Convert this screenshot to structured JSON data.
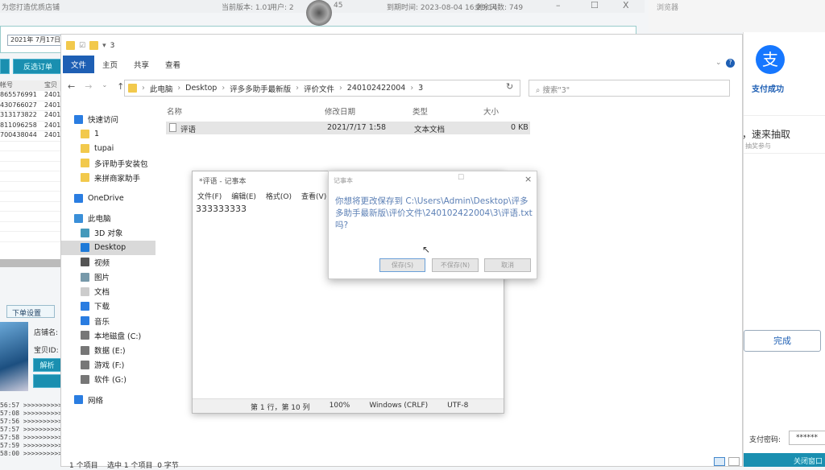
{
  "app": {
    "title": "为您打造优质店铺",
    "version": "当前版本: 1.01",
    "user": "用户: 2",
    "user_tail": "45",
    "expiry": "到期时间: 2023-08-04 16:29:14",
    "days_left": "剩余天数: 749",
    "date_from": "2021年 7月17日",
    "invert_button": "反选订单",
    "table": {
      "headers": [
        "帐号",
        "宝贝"
      ],
      "rows": [
        [
          "865576991",
          "2401"
        ],
        [
          "430766027",
          "2401"
        ],
        [
          "313173822",
          "2401"
        ],
        [
          "811096258",
          "2401"
        ],
        [
          "700438044",
          "2401"
        ]
      ]
    },
    "order_tab": "下单设置",
    "shop_label": "店铺名:",
    "item_label": "宝贝ID:",
    "parse_button": "解析",
    "logs": [
      "56:57 >>>>>>>>>>",
      "57:08 >>>>>>>>>>",
      "57:56 >>>>>>>>>>",
      "57:57 >>>>>>>>>>",
      "57:58 >>>>>>>>>>",
      "57:59 >>>>>>>>>>",
      "58:00 >>>>>>>>>>"
    ]
  },
  "browser": {
    "title": "浏览器",
    "pay_success": "支付成功",
    "promo": "，速来抽取",
    "promo_sub": "抽奖参与",
    "done": "完成",
    "password_label": "支付密码:",
    "password_value": "******",
    "close": "关闭窗口",
    "accent": "#1677ff"
  },
  "explorer": {
    "title": "3",
    "ribbon": [
      "文件",
      "主页",
      "共享",
      "查看"
    ],
    "path": [
      "此电脑",
      "Desktop",
      "评多多助手最新版",
      "评价文件",
      "240102422004",
      "3"
    ],
    "search_placeholder": "搜索\"3\"",
    "nav": [
      {
        "label": "快速访问",
        "icon": "star-icon",
        "top": true
      },
      {
        "label": "1",
        "icon": "folder-icon"
      },
      {
        "label": "tupai",
        "icon": "folder-icon"
      },
      {
        "label": "多评助手安装包",
        "icon": "folder-icon"
      },
      {
        "label": "来拼商家助手",
        "icon": "folder-icon"
      },
      {
        "label": "OneDrive",
        "icon": "cloud-icon",
        "top": true
      },
      {
        "label": "此电脑",
        "icon": "computer-icon",
        "top": true
      },
      {
        "label": "3D 对象",
        "icon": "cube-icon"
      },
      {
        "label": "Desktop",
        "icon": "desktop-icon",
        "selected": true
      },
      {
        "label": "视频",
        "icon": "video-icon"
      },
      {
        "label": "图片",
        "icon": "picture-icon"
      },
      {
        "label": "文档",
        "icon": "document-icon"
      },
      {
        "label": "下载",
        "icon": "download-icon"
      },
      {
        "label": "音乐",
        "icon": "music-icon"
      },
      {
        "label": "本地磁盘 (C:)",
        "icon": "drive-icon"
      },
      {
        "label": "数据 (E:)",
        "icon": "drive-icon"
      },
      {
        "label": "游戏 (F:)",
        "icon": "drive-icon"
      },
      {
        "label": "软件 (G:)",
        "icon": "drive-icon"
      },
      {
        "label": "网络",
        "icon": "network-icon",
        "top": true
      }
    ],
    "columns": [
      "名称",
      "修改日期",
      "类型",
      "大小"
    ],
    "files": [
      {
        "name": "评语",
        "date": "2021/7/17 1:58",
        "type": "文本文档",
        "size": "0 KB"
      }
    ],
    "status": "1 个项目    选中 1 个项目  0 字节"
  },
  "notepad": {
    "title": "*评语 - 记事本",
    "menu": [
      "文件(F)",
      "编辑(E)",
      "格式(O)",
      "查看(V)"
    ],
    "content": "333333333",
    "status": [
      "第 1 行，第 10 列",
      "100%",
      "Windows (CRLF)",
      "UTF-8"
    ]
  },
  "dialog": {
    "title": "记事本",
    "message": "你想将更改保存到 C:\\Users\\Admin\\Desktop\\评多多助手最新版\\评价文件\\240102422004\\3\\评语.txt 吗?",
    "save": "保存(S)",
    "dont_save": "不保存(N)",
    "cancel": "取消"
  }
}
